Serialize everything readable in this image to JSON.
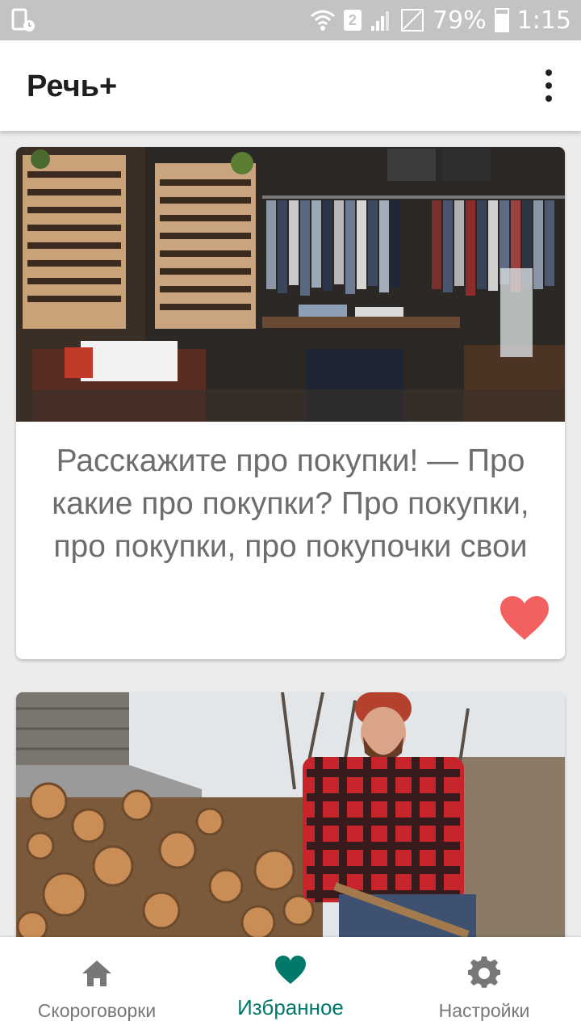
{
  "status_bar": {
    "battery_percent": "79%",
    "time": "1:15",
    "sim_slot": "2",
    "battery_level": 0.79,
    "icons": [
      "storage-clock-icon",
      "wifi-icon",
      "sim-icon",
      "signal-icon",
      "no-signal-icon",
      "battery-charging-icon"
    ]
  },
  "app_bar": {
    "title": "Речь+",
    "menu_icon": "more-vertical-icon"
  },
  "feed": {
    "cards": [
      {
        "text": "Расскажите про покупки! — Про какие про покупки? Про покупки, про покупки, про покупочки свои",
        "image": "clothing-store-photo",
        "favorite": true,
        "favorite_icon": "heart-icon"
      },
      {
        "text": "",
        "image": "lumberjack-firewood-photo",
        "favorite": true
      }
    ]
  },
  "bottom_nav": {
    "active_tab": "Избранное",
    "items": [
      {
        "label": "Скороговорки",
        "icon": "home-icon",
        "active": false
      },
      {
        "label": "Избранное",
        "icon": "heart-icon",
        "active": true
      },
      {
        "label": "Настройки",
        "icon": "gear-icon",
        "active": false
      }
    ]
  },
  "colors": {
    "accent": "#00796b",
    "favorite": "#f26060",
    "status_bar": "#c3c3c3",
    "inactive_nav": "#777777"
  }
}
